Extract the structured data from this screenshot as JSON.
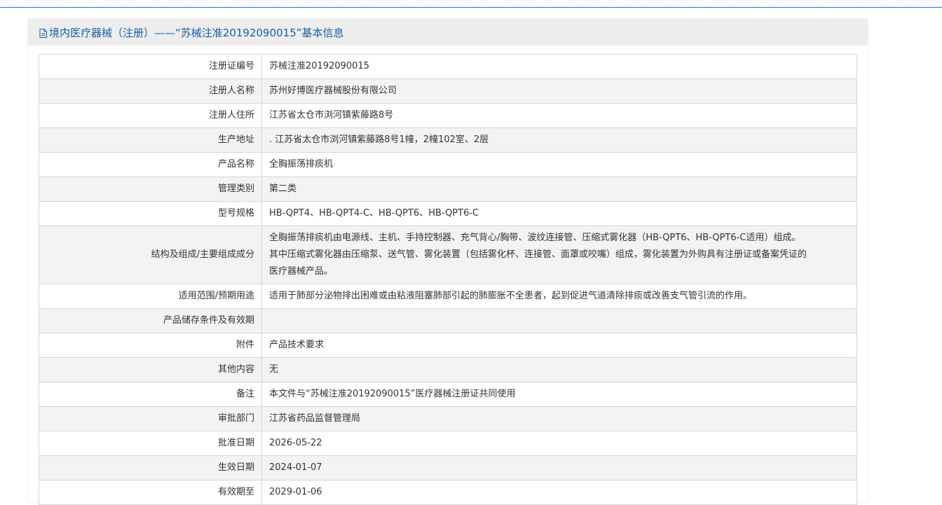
{
  "header": {
    "title": "境内医疗器械（注册）——“苏械注准20192090015”基本信息"
  },
  "icons": {
    "header_icon": "document-icon"
  },
  "colors": {
    "header_text": "#1a5fa6",
    "header_background": "#ededed",
    "stripe_row": "#f3f3f3",
    "top_rule": "#2f73b8"
  },
  "rows": [
    {
      "label": "注册证编号",
      "value": "苏械注准20192090015"
    },
    {
      "label": "注册人名称",
      "value": "苏州好博医疗器械股份有限公司"
    },
    {
      "label": "注册人住所",
      "value": "江苏省太仓市浏河镇紫藤路8号"
    },
    {
      "label": "生产地址",
      "value": ". 江苏省太仓市浏河镇紫藤路8号1幢，2幢102室、2层"
    },
    {
      "label": "产品名称",
      "value": "全胸振荡排痰机"
    },
    {
      "label": "管理类别",
      "value": "第二类"
    },
    {
      "label": "型号规格",
      "value": "HB-QPT4、HB-QPT4-C、HB-QPT6、HB-QPT6-C"
    },
    {
      "label": "结构及组成/主要组成成分",
      "value_lines": [
        "全胸振荡排痰机由电源线、主机、手持控制器、充气背心/胸带、波纹连接管、压缩式雾化器（HB-QPT6、HB-QPT6-C适用）组成。",
        "其中压缩式雾化器由压缩泵、送气管、雾化装置（包括雾化杯、连接管、面罩或咬嘴）组成，雾化装置为外购具有注册证或备案凭证的",
        "医疗器械产品。"
      ]
    },
    {
      "label": "适用范围/预期用途",
      "value": "适用于肺部分泌物排出困难或由粘液阻塞肺部引起的肺膨胀不全患者，起到促进气道清除排痰或改善支气管引流的作用。"
    },
    {
      "label": "产品储存条件及有效期",
      "value": ""
    },
    {
      "label": "附件",
      "value": "产品技术要求"
    },
    {
      "label": "其他内容",
      "value": "无"
    },
    {
      "label": "备注",
      "value": "本文件与“苏械注准20192090015”医疗器械注册证共同使用"
    },
    {
      "label": "审批部门",
      "value": "江苏省药品监督管理局"
    },
    {
      "label": "批准日期",
      "value": "2026-05-22"
    },
    {
      "label": "生效日期",
      "value": "2024-01-07"
    },
    {
      "label": "有效期至",
      "value": "2029-01-06"
    }
  ]
}
